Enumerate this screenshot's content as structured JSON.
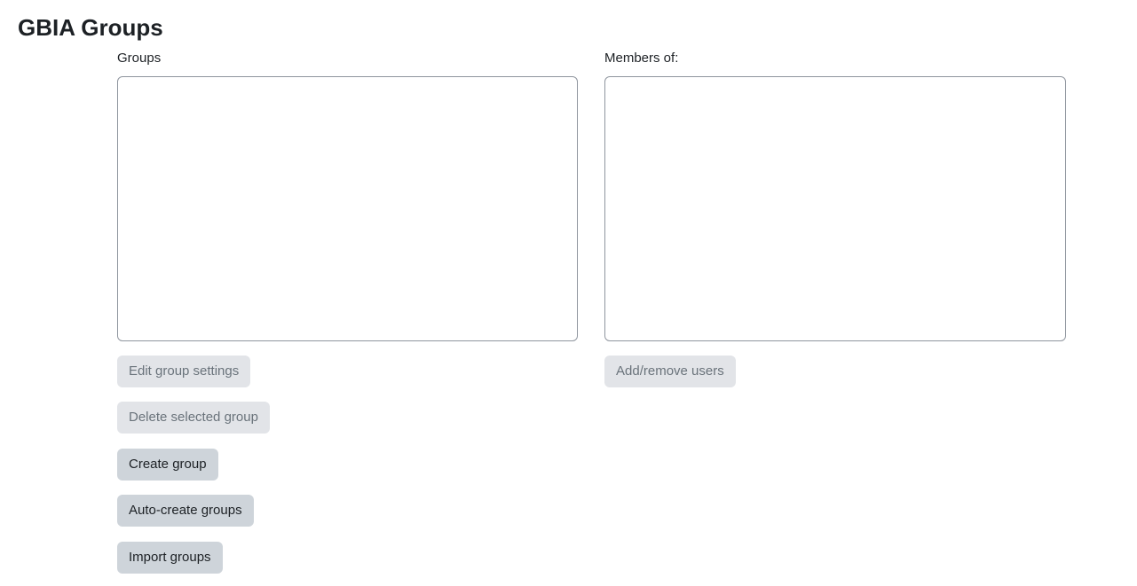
{
  "page": {
    "title": "GBIA Groups"
  },
  "groups_panel": {
    "label": "Groups",
    "items": []
  },
  "members_panel": {
    "label": "Members of:",
    "items": []
  },
  "buttons": {
    "edit_group_settings": "Edit group settings",
    "delete_selected_group": "Delete selected group",
    "create_group": "Create group",
    "auto_create_groups": "Auto-create groups",
    "import_groups": "Import groups",
    "add_remove_users": "Add/remove users"
  },
  "colors": {
    "button_enabled_bg": "#ced4da",
    "button_disabled_bg": "#e2e4e8",
    "listbox_border": "#8f959e"
  }
}
